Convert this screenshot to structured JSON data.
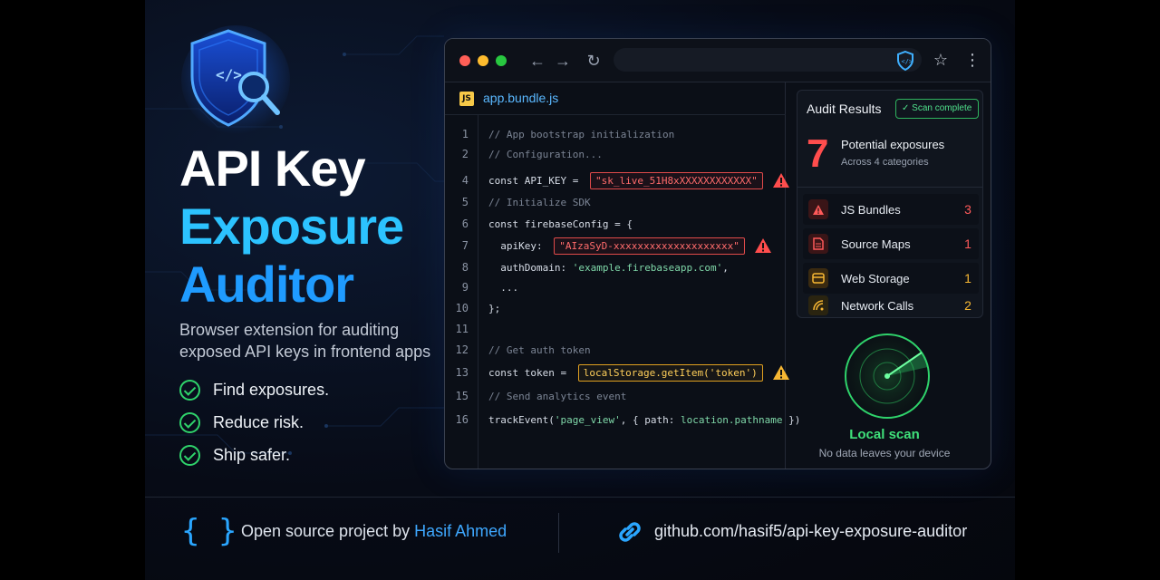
{
  "hero": {
    "title_line1": "API Key",
    "title_line2": "Exposure",
    "title_line3": "Auditor",
    "subtitle": "Browser extension for auditing exposed API keys in frontend apps",
    "features": [
      "Find exposures.",
      "Reduce risk.",
      "Ship safer."
    ]
  },
  "browser": {
    "file_badge": "JS",
    "file_name": "app.bundle.js",
    "code_lines": [
      {
        "num": "1",
        "parts": [
          {
            "t": "// App bootstrap initialization",
            "c": "cm"
          }
        ]
      },
      {
        "num": "2",
        "parts": [
          {
            "t": "// Configuration...",
            "c": "cm"
          }
        ]
      },
      {
        "num": "4",
        "parts": [
          {
            "t": "const API_KEY = ",
            "c": "kw"
          },
          {
            "t": "\"sk_live_51H8xXXXXXXXXXXXX\"",
            "c": "key"
          }
        ],
        "flag": "red"
      },
      {
        "num": "5",
        "parts": [
          {
            "t": "// Initialize SDK",
            "c": "cm"
          }
        ]
      },
      {
        "num": "6",
        "parts": [
          {
            "t": "const firebaseConfig = {",
            "c": "kw"
          }
        ]
      },
      {
        "num": "7",
        "parts": [
          {
            "t": "  apiKey: ",
            "c": "kw"
          },
          {
            "t": "\"AIzaSyD-xxxxxxxxxxxxxxxxxxxx\"",
            "c": "key"
          }
        ],
        "flag": "red"
      },
      {
        "num": "8",
        "parts": [
          {
            "t": "  authDomain: ",
            "c": "kw"
          },
          {
            "t": "'example.firebaseapp.com'",
            "c": "str"
          },
          {
            "t": ",",
            "c": "kw"
          }
        ]
      },
      {
        "num": "9",
        "parts": [
          {
            "t": "  ...",
            "c": "kw"
          }
        ]
      },
      {
        "num": "10",
        "parts": [
          {
            "t": "};",
            "c": "kw"
          }
        ]
      },
      {
        "num": "11",
        "parts": []
      },
      {
        "num": "12",
        "parts": [
          {
            "t": "// Get auth token",
            "c": "cm"
          }
        ]
      },
      {
        "num": "13",
        "parts": [
          {
            "t": "const token = ",
            "c": "kw"
          },
          {
            "t": "localStorage.getItem('token')",
            "c": "warn"
          }
        ],
        "flag": "yellow"
      },
      {
        "num": "15",
        "parts": [
          {
            "t": "// Send analytics event",
            "c": "cm"
          }
        ]
      },
      {
        "num": "16",
        "parts": [
          {
            "t": "trackEvent(",
            "c": "kw"
          },
          {
            "t": "'page_view'",
            "c": "str"
          },
          {
            "t": ", { path: ",
            "c": "kw"
          },
          {
            "t": "location.pathname",
            "c": "str"
          },
          {
            "t": " })",
            "c": "kw"
          }
        ]
      }
    ]
  },
  "audit": {
    "title": "Audit Results",
    "badge": "✓ Scan complete",
    "count": "7",
    "count_label": "Potential exposures",
    "count_sub": "Across 4 categories",
    "rows": [
      {
        "label": "JS Bundles",
        "count": "3",
        "color": "#ff5a5a",
        "icon": "warning-icon"
      },
      {
        "label": "Source Maps",
        "count": "1",
        "color": "#ff5a5a",
        "icon": "file-icon"
      },
      {
        "label": "Web Storage",
        "count": "1",
        "color": "#f7b733",
        "icon": "storage-icon"
      },
      {
        "label": "Network Calls",
        "count": "2",
        "color": "#f7b733",
        "icon": "signal-icon"
      }
    ]
  },
  "local": {
    "title": "Local scan",
    "sub": "No data leaves your device"
  },
  "footer": {
    "braces": "{ }",
    "prefix": "Open source project by ",
    "author": "Hasif Ahmed",
    "url": "github.com/hasif5/api-key-exposure-auditor"
  },
  "colors": {
    "accent_blue": "#2cc3ff",
    "danger": "#ff4d4d",
    "warning": "#f7b733",
    "success": "#2fd36b"
  }
}
